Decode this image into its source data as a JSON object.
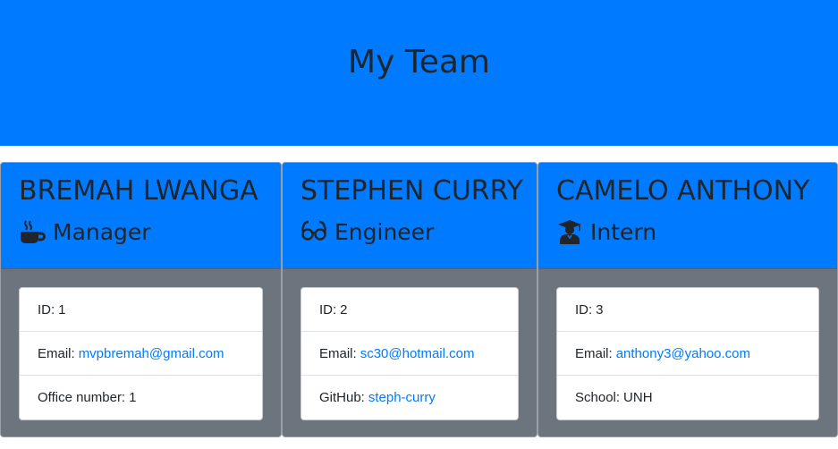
{
  "header": {
    "title": "My Team"
  },
  "colors": {
    "primary": "#007bff",
    "body": "#6c757d",
    "link": "#007bff"
  },
  "cards": [
    {
      "name": "BREMAH LWANGA",
      "role": "Manager",
      "icon": "coffee-mug-icon",
      "id_label": "ID:",
      "id": "1",
      "email_label": "Email:",
      "email": "mvpbremah@gmail.com",
      "extra_label": "Office number:",
      "extra": "1"
    },
    {
      "name": "STEPHEN CURRY",
      "role": "Engineer",
      "icon": "glasses-icon",
      "id_label": "ID:",
      "id": "2",
      "email_label": "Email:",
      "email": "sc30@hotmail.com",
      "extra_label": "GitHub:",
      "extra": "steph-curry"
    },
    {
      "name": "CAMELO ANTHONY",
      "role": "Intern",
      "icon": "graduate-icon",
      "id_label": "ID:",
      "id": "3",
      "email_label": "Email:",
      "email": "anthony3@yahoo.com",
      "extra_label": "School:",
      "extra": "UNH"
    }
  ]
}
